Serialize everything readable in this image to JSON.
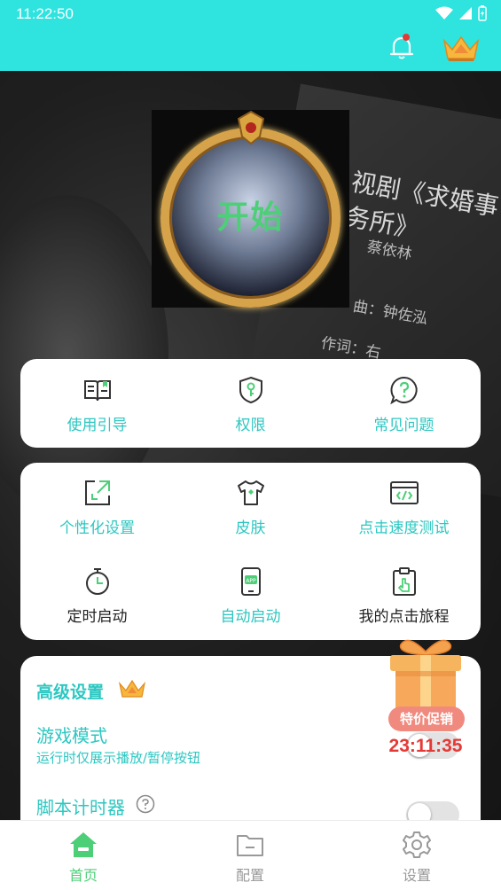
{
  "status": {
    "time": "11:22:50"
  },
  "background": {
    "line1": "视剧《求婚事务所》",
    "line2": "蔡依林",
    "line3": "曲：钟佐泓",
    "line4": "作词：右"
  },
  "avatar": {
    "start_label": "开始"
  },
  "quick_actions": [
    {
      "label": "使用引导",
      "icon": "book-icon"
    },
    {
      "label": "权限",
      "icon": "shield-key-icon"
    },
    {
      "label": "常见问题",
      "icon": "question-icon"
    }
  ],
  "features": [
    {
      "label": "个性化设置",
      "icon": "resize-icon",
      "color": "teal"
    },
    {
      "label": "皮肤",
      "icon": "tshirt-icon",
      "color": "teal"
    },
    {
      "label": "点击速度测试",
      "icon": "code-window-icon",
      "color": "teal"
    },
    {
      "label": "定时启动",
      "icon": "timer-icon",
      "color": "dark"
    },
    {
      "label": "自动启动",
      "icon": "app-phone-icon",
      "color": "teal"
    },
    {
      "label": "我的点击旅程",
      "icon": "clipboard-tap-icon",
      "color": "dark"
    }
  ],
  "advanced": {
    "title": "高级设置",
    "game_mode_title": "游戏模式",
    "game_mode_sub": "运行时仅展示播放/暂停按钮",
    "game_mode_on": false,
    "script_timer_title": "脚本计时器",
    "script_timer_on": false
  },
  "promo": {
    "badge": "特价促销",
    "timer": "23:11:35"
  },
  "nav": [
    {
      "label": "首页",
      "icon": "home-icon",
      "active": true
    },
    {
      "label": "配置",
      "icon": "folder-icon",
      "active": false
    },
    {
      "label": "设置",
      "icon": "gear-icon",
      "active": false
    }
  ],
  "colors": {
    "accent": "#2fe3df",
    "teal_text": "#2cc7c1",
    "green": "#4ccf77",
    "promo_red": "#e53935"
  }
}
